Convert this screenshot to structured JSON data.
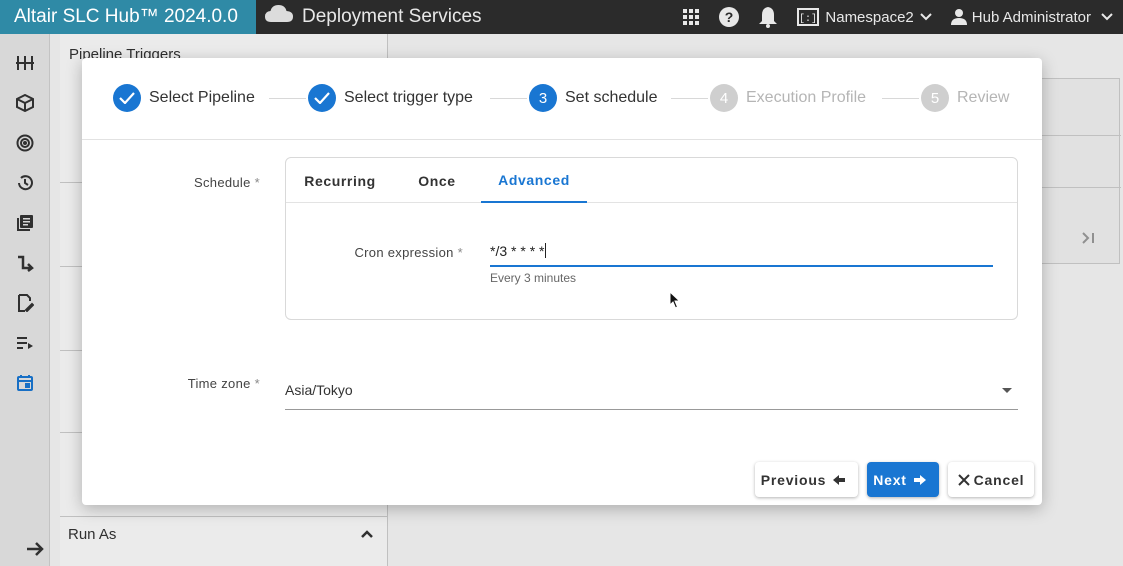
{
  "topbar": {
    "app_title": "Altair SLC Hub™ 2024.0.0",
    "service_title": "Deployment Services",
    "namespace": "Namespace2",
    "user": "Hub Administrator"
  },
  "background": {
    "panel_title": "Pipeline Triggers",
    "run_as_label": "Run As"
  },
  "stepper": {
    "steps": [
      {
        "number": "1",
        "label": "Select Pipeline",
        "state": "done"
      },
      {
        "number": "2",
        "label": "Select trigger type",
        "state": "done"
      },
      {
        "number": "3",
        "label": "Set schedule",
        "state": "active"
      },
      {
        "number": "4",
        "label": "Execution Profile",
        "state": "pending"
      },
      {
        "number": "5",
        "label": "Review",
        "state": "pending"
      }
    ]
  },
  "form": {
    "schedule_label": "Schedule",
    "required_mark": "*",
    "tabs": [
      "Recurring",
      "Once",
      "Advanced"
    ],
    "active_tab": "Advanced",
    "cron_label": "Cron expression",
    "cron_value": "*/3 * * * *",
    "cron_hint": "Every 3 minutes",
    "timezone_label": "Time zone",
    "timezone_value": "Asia/Tokyo"
  },
  "buttons": {
    "previous": "Previous",
    "next": "Next",
    "cancel": "Cancel"
  },
  "colors": {
    "accent": "#1976d2",
    "brand_bar": "#2f8aa6",
    "topbar": "#2b2b2b"
  }
}
